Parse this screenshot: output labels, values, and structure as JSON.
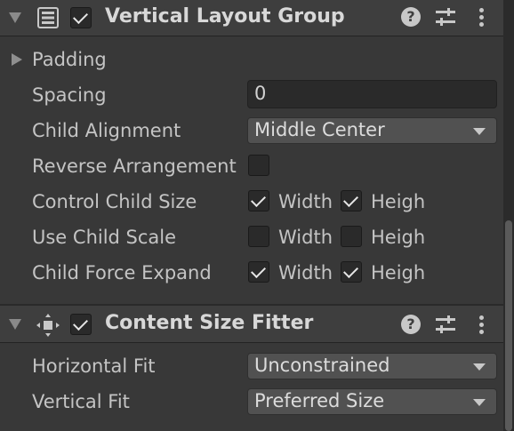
{
  "components": [
    {
      "title": "Vertical Layout Group",
      "icon": "vertical-layout-icon",
      "enabled": true,
      "padding_label": "Padding",
      "spacing": {
        "label": "Spacing",
        "value": "0"
      },
      "child_alignment": {
        "label": "Child Alignment",
        "value": "Middle Center"
      },
      "reverse_arrangement": {
        "label": "Reverse Arrangement",
        "checked": false
      },
      "control_child_size": {
        "label": "Control Child Size",
        "width_label": "Width",
        "height_label": "Heigh",
        "width": true,
        "height": true
      },
      "use_child_scale": {
        "label": "Use Child Scale",
        "width_label": "Width",
        "height_label": "Heigh",
        "width": false,
        "height": false
      },
      "child_force_expand": {
        "label": "Child Force Expand",
        "width_label": "Width",
        "height_label": "Heigh",
        "width": true,
        "height": true
      }
    },
    {
      "title": "Content Size Fitter",
      "icon": "content-size-fitter-icon",
      "enabled": true,
      "horizontal_fit": {
        "label": "Horizontal Fit",
        "value": "Unconstrained"
      },
      "vertical_fit": {
        "label": "Vertical Fit",
        "value": "Preferred Size"
      }
    }
  ],
  "header_icons": {
    "help": "?",
    "presets": "sliders-icon",
    "menu": "kebab-menu-icon"
  }
}
